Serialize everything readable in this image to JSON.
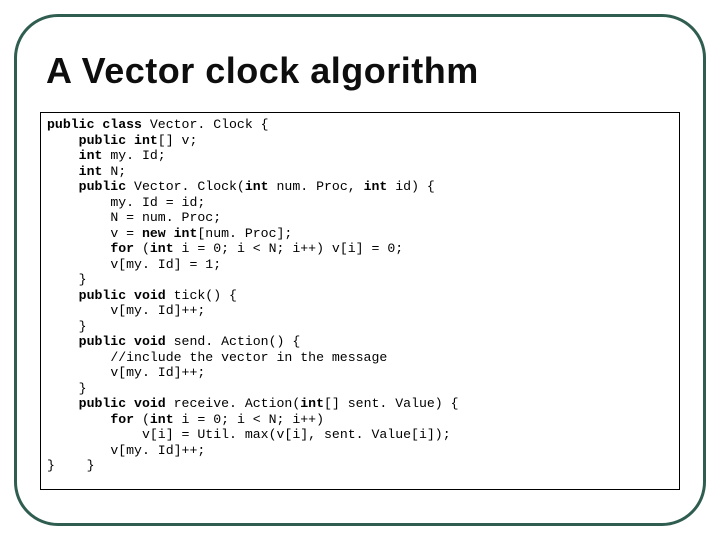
{
  "title": "A Vector clock algorithm",
  "code": {
    "l1_kw1": "public class",
    "l1_txt": " Vector. Clock {",
    "l2_kw1": "public int",
    "l2_txt": "[] v;",
    "l3_kw1": "int",
    "l3_txt": " my. Id;",
    "l4_kw1": "int",
    "l4_txt": " N;",
    "l5_kw1": "public",
    "l5_txt1": " Vector. Clock(",
    "l5_kw2": "int",
    "l5_txt2": " num. Proc, ",
    "l5_kw3": "int",
    "l5_txt3": " id) {",
    "l6_txt": "my. Id = id;",
    "l7_txt": "N = num. Proc;",
    "l8_txt1": "v = ",
    "l8_kw1": "new int",
    "l8_txt2": "[num. Proc];",
    "l9_kw1": "for",
    "l9_txt1": " (",
    "l9_kw2": "int",
    "l9_txt2": " i = 0; i < N; i++) v[i] = 0;",
    "l10_txt": "v[my. Id] = 1;",
    "l11_txt": "}",
    "l12_kw1": "public void",
    "l12_txt": " tick() {",
    "l13_txt": "v[my. Id]++;",
    "l14_txt": "}",
    "l15_kw1": "public void",
    "l15_txt": " send. Action() {",
    "l16_txt": "//include the vector in the message",
    "l17_txt": "v[my. Id]++;",
    "l18_txt": "}",
    "l19_kw1": "public void",
    "l19_txt1": " receive. Action(",
    "l19_kw2": "int",
    "l19_txt2": "[] sent. Value) {",
    "l20_kw1": "for",
    "l20_txt1": " (",
    "l20_kw2": "int",
    "l20_txt2": " i = 0; i < N; i++)",
    "l21_txt": "v[i] = Util. max(v[i], sent. Value[i]);",
    "l22_txt": "v[my. Id]++;",
    "l23_txt": "}    }"
  }
}
